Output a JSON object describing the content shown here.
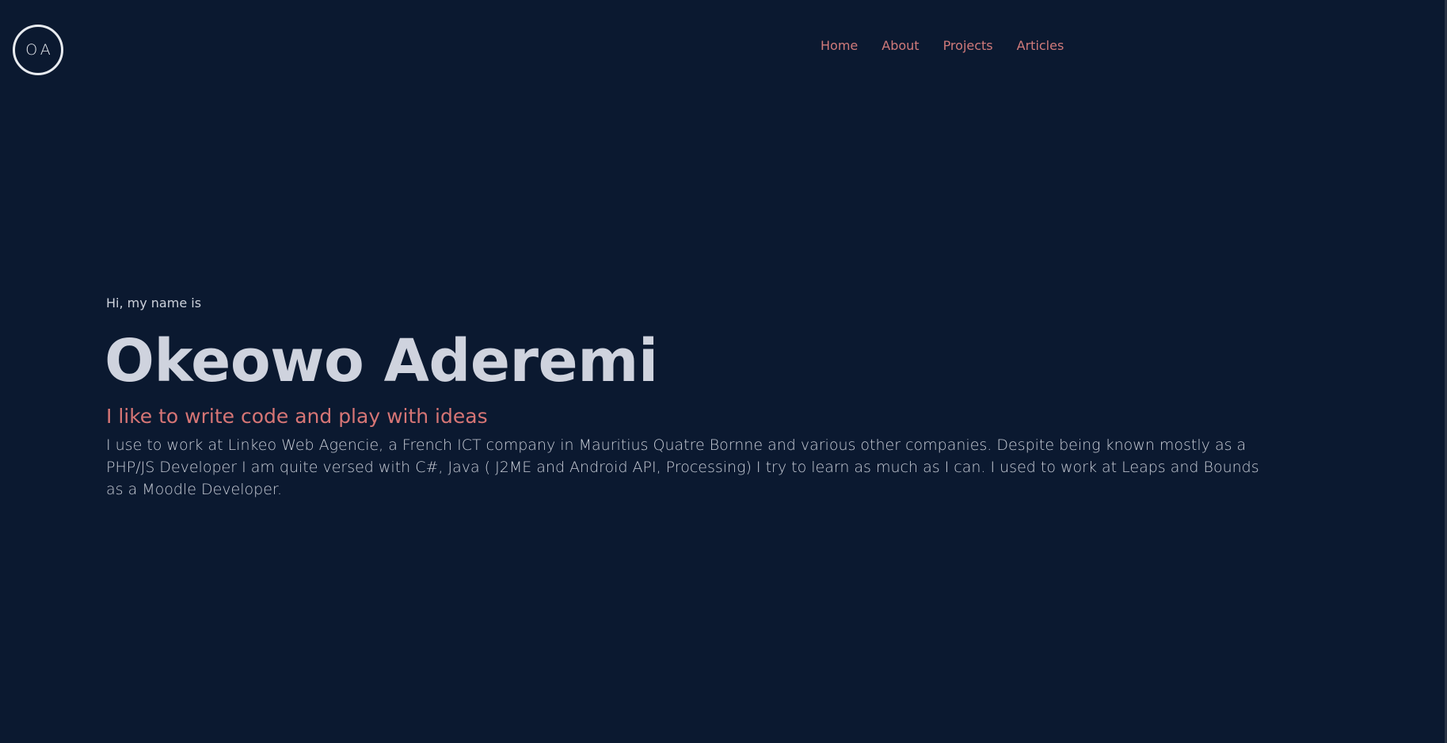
{
  "logo": {
    "initials": "OA"
  },
  "nav": {
    "items": [
      {
        "label": "Home"
      },
      {
        "label": "About"
      },
      {
        "label": "Projects"
      },
      {
        "label": "Articles"
      }
    ]
  },
  "hero": {
    "intro": "Hi, my name is",
    "name": "Okeowo Aderemi",
    "tagline": "I like to write code and play with ideas",
    "bio": "I use to work at Linkeo Web Agencie, a French ICT company in Mauritius Quatre Bornne and various other companies. Despite being known mostly as a PHP/JS Developer I am quite versed with C#, Java ( J2ME and Android API, Processing) I try to learn as much as I can. I used to work at Leaps and Bounds as a Moodle Developer."
  },
  "colors": {
    "background": "#0b1930",
    "accent": "#d07a7a",
    "text": "#cfd3de"
  }
}
